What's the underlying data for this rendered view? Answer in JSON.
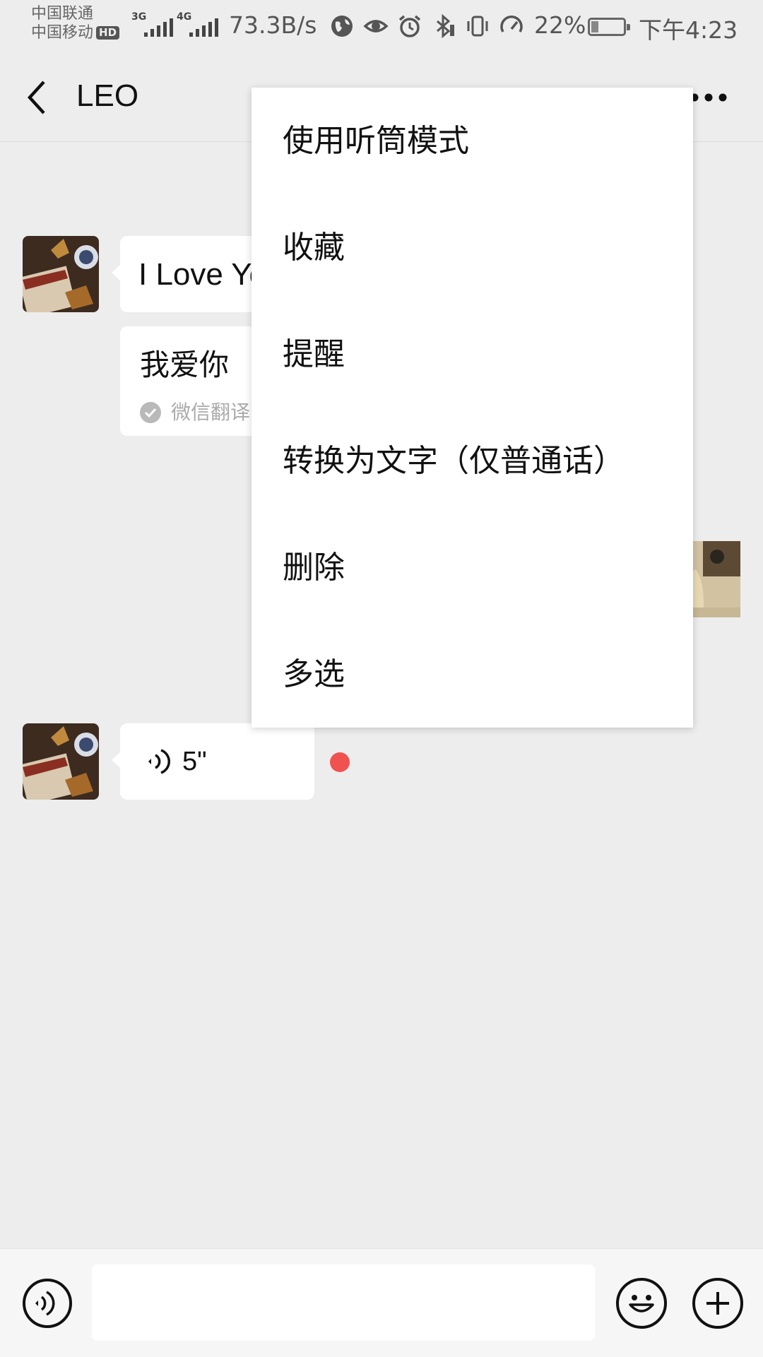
{
  "status_bar": {
    "carrier_1": "中国联通",
    "carrier_2": "中国移动",
    "hd_badge": "HD",
    "network_1": "3G",
    "network_2": "4G",
    "net_speed": "73.3B/s",
    "battery_percent": "22%",
    "battery_level": 0.22,
    "time": "下午4:23",
    "icons": [
      "globe-icon",
      "eye-icon",
      "alarm-icon",
      "bluetooth-icon",
      "vibrate-icon",
      "speed-icon"
    ]
  },
  "header": {
    "title": "LEO",
    "back_icon": "chevron-left-icon",
    "more_icon": "more-horizontal-icon"
  },
  "messages": [
    {
      "type": "text",
      "sender": "left",
      "text": "I Love Yo"
    },
    {
      "type": "translation",
      "sender": "left",
      "text": "我爱你",
      "source": "微信翻译"
    },
    {
      "type": "image",
      "sender": "right"
    },
    {
      "type": "voice",
      "sender": "left",
      "duration": "5\"",
      "unread": true
    }
  ],
  "context_menu": {
    "items": [
      "使用听筒模式",
      "收藏",
      "提醒",
      "转换为文字（仅普通话）",
      "删除",
      "多选"
    ]
  },
  "input_bar": {
    "voice_icon": "voice-mode-icon",
    "emoji_icon": "emoji-icon",
    "plus_icon": "plus-icon",
    "input_value": ""
  },
  "colors": {
    "background": "#ededed",
    "bubble": "#ffffff",
    "unread_dot": "#f05250",
    "text": "#111111"
  }
}
